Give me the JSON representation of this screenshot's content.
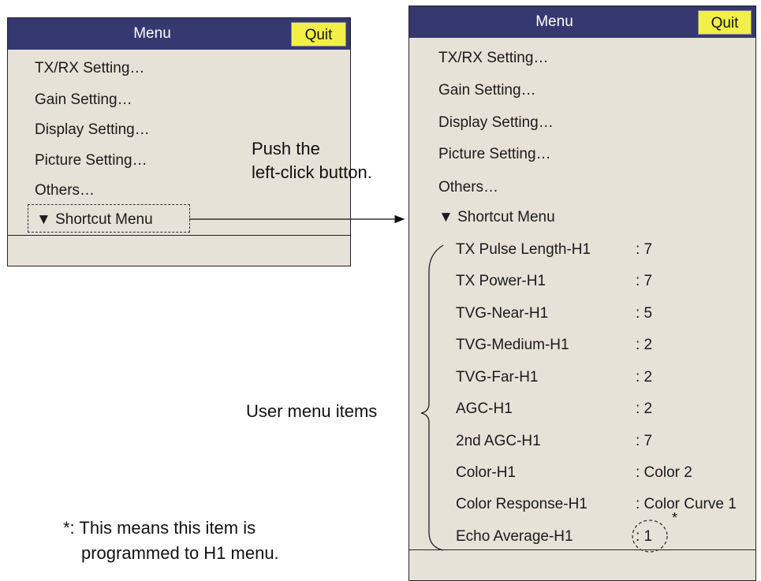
{
  "left_menu": {
    "title": "Menu",
    "quit_label": "Quit",
    "items": [
      "TX/RX Setting…",
      "Gain Setting…",
      "Display Setting…",
      "Picture Setting…",
      "Others…"
    ],
    "shortcut_label": "▼ Shortcut Menu"
  },
  "right_menu": {
    "title": "Menu",
    "quit_label": "Quit",
    "items": [
      "TX/RX Setting…",
      "Gain Setting…",
      "Display Setting…",
      "Picture Setting…",
      "Others…"
    ],
    "shortcut_label": "▼ Shortcut Menu",
    "user_items": [
      {
        "label": "TX Pulse Length-H1",
        "value": ": 7"
      },
      {
        "label": "TX Power-H1",
        "value": ": 7"
      },
      {
        "label": "TVG-Near-H1",
        "value": ": 5"
      },
      {
        "label": "TVG-Medium-H1",
        "value": ": 2"
      },
      {
        "label": "TVG-Far-H1",
        "value": ": 2"
      },
      {
        "label": "AGC-H1",
        "value": ": 2"
      },
      {
        "label": "2nd AGC-H1",
        "value": ": 7"
      },
      {
        "label": "Color-H1",
        "value": ": Color 2"
      },
      {
        "label": "Color Response-H1",
        "value": ": Color Curve 1"
      },
      {
        "label": "Echo Average-H1",
        "value": ": 1"
      }
    ]
  },
  "annotations": {
    "push_line1": "Push the",
    "push_line2": "left-click button.",
    "user_menu_items": "User menu items",
    "asterisk": "*",
    "footnote_line1": "*: This means this item is",
    "footnote_line2": "programmed to H1 menu."
  },
  "colors": {
    "titlebar": "#363970",
    "quit_button": "#f2f048",
    "menu_background": "#e6e2d8"
  }
}
